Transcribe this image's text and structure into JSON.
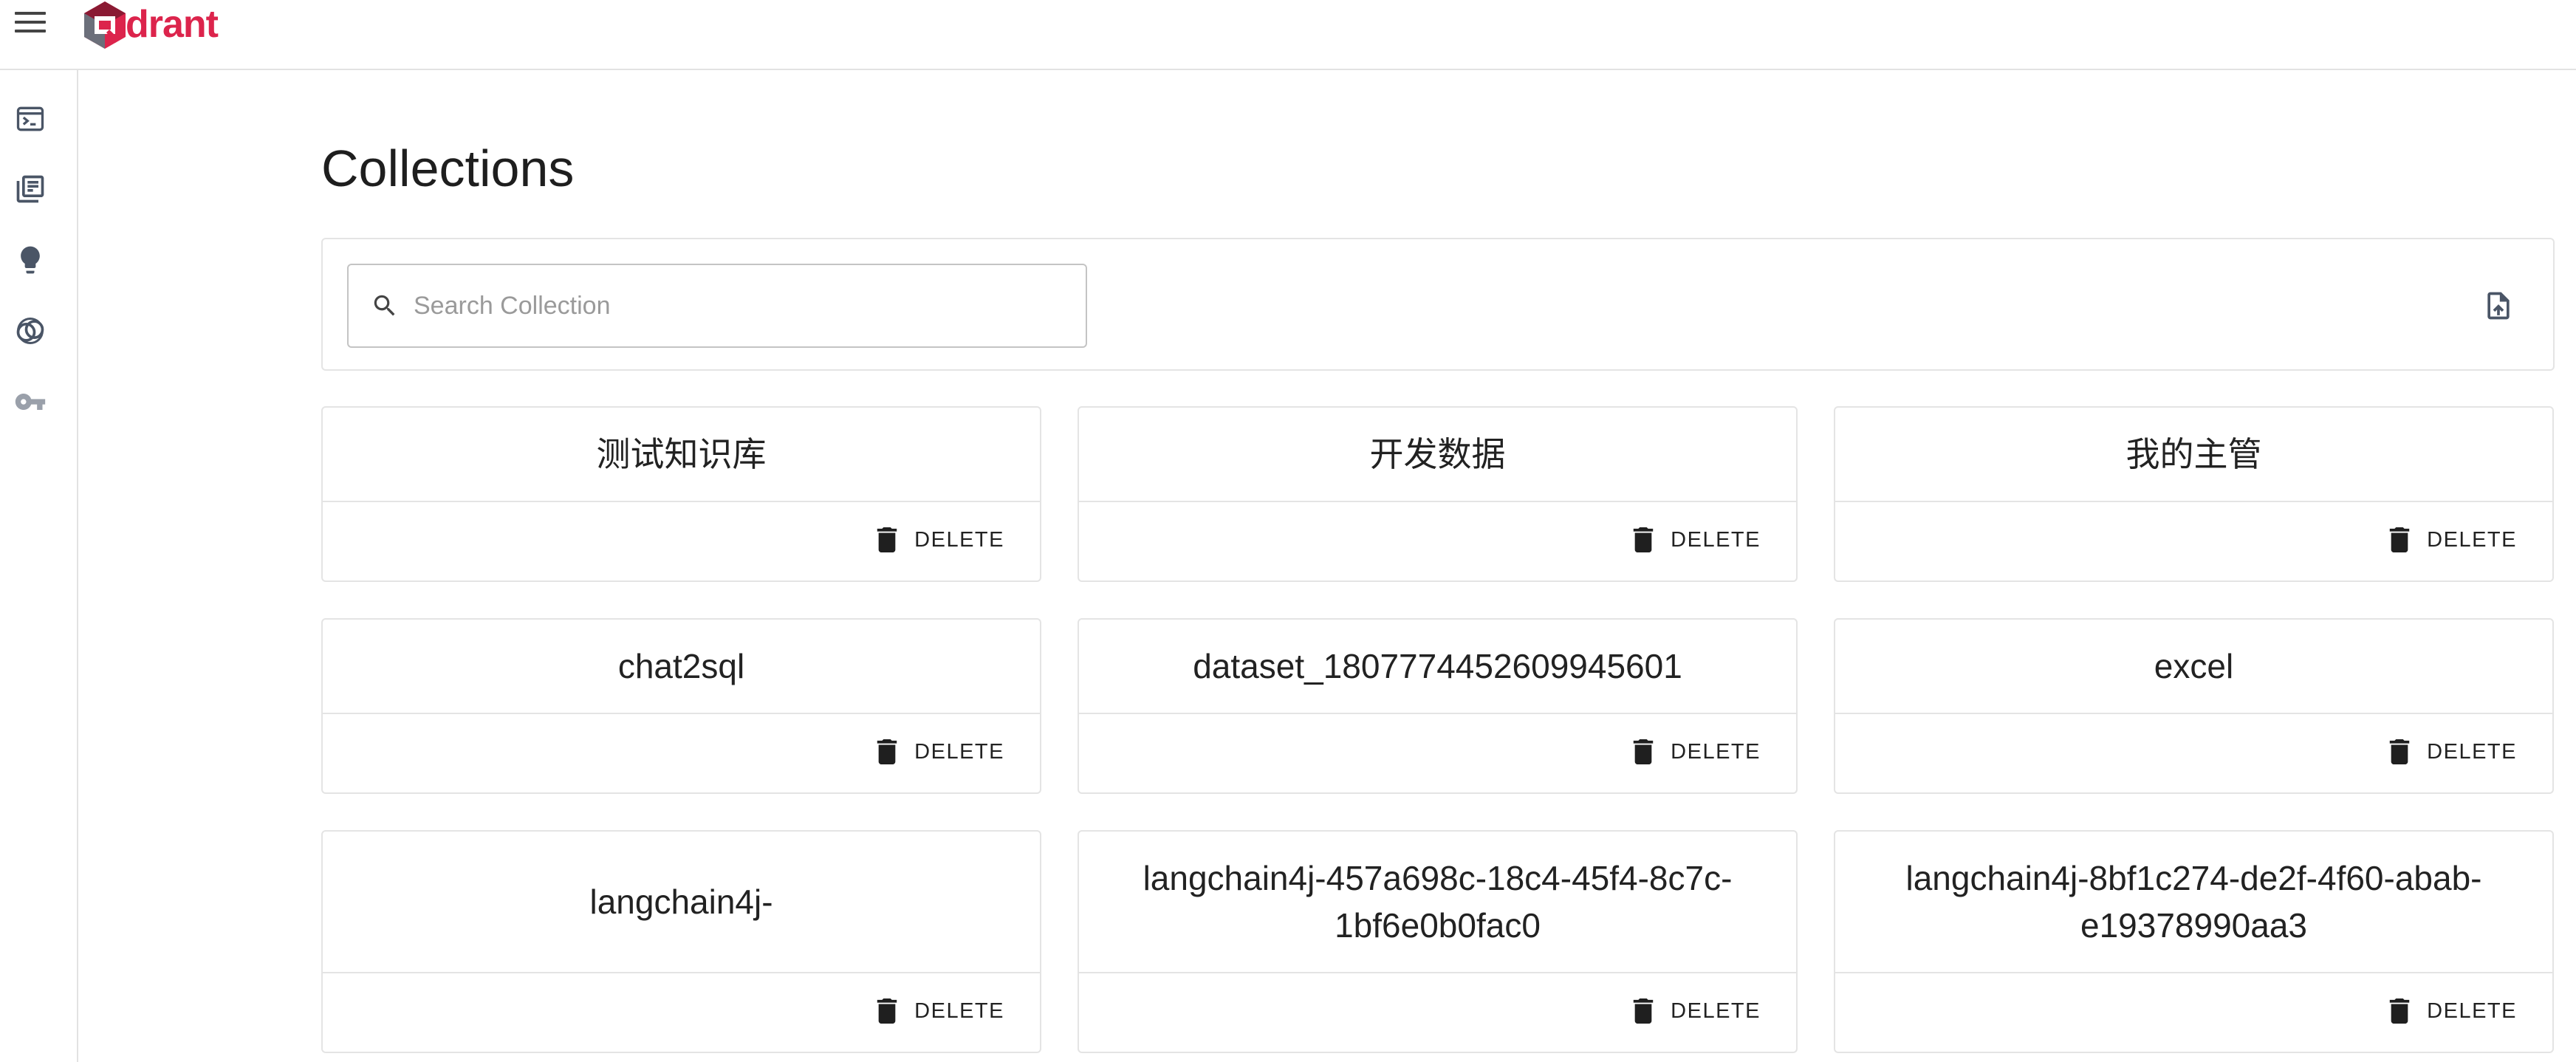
{
  "app": {
    "logo_text": "drant"
  },
  "sidebar": {
    "items": [
      {
        "name": "console",
        "icon": "terminal-icon"
      },
      {
        "name": "collections",
        "icon": "library-books-icon"
      },
      {
        "name": "tutorial",
        "icon": "lightbulb-icon"
      },
      {
        "name": "datasets",
        "icon": "linked-rings-icon"
      },
      {
        "name": "access",
        "icon": "key-icon"
      }
    ]
  },
  "page": {
    "title": "Collections"
  },
  "search": {
    "placeholder": "Search Collection",
    "value": ""
  },
  "collections": [
    {
      "name": "测试知识库",
      "delete_label": "DELETE"
    },
    {
      "name": "开发数据",
      "delete_label": "DELETE"
    },
    {
      "name": "我的主管",
      "delete_label": "DELETE"
    },
    {
      "name": "chat2sql",
      "delete_label": "DELETE"
    },
    {
      "name": "dataset_1807774452609945601",
      "delete_label": "DELETE"
    },
    {
      "name": "excel",
      "delete_label": "DELETE"
    },
    {
      "name": "langchain4j-",
      "delete_label": "DELETE"
    },
    {
      "name": "langchain4j-457a698c-18c4-45f4-8c7c-1bf6e0b0fac0",
      "delete_label": "DELETE"
    },
    {
      "name": "langchain4j-8bf1c274-de2f-4f60-abab-e19378990aa3",
      "delete_label": "DELETE"
    }
  ],
  "colors": {
    "brand": "#dc244c",
    "icon_gray": "#4a5566"
  }
}
